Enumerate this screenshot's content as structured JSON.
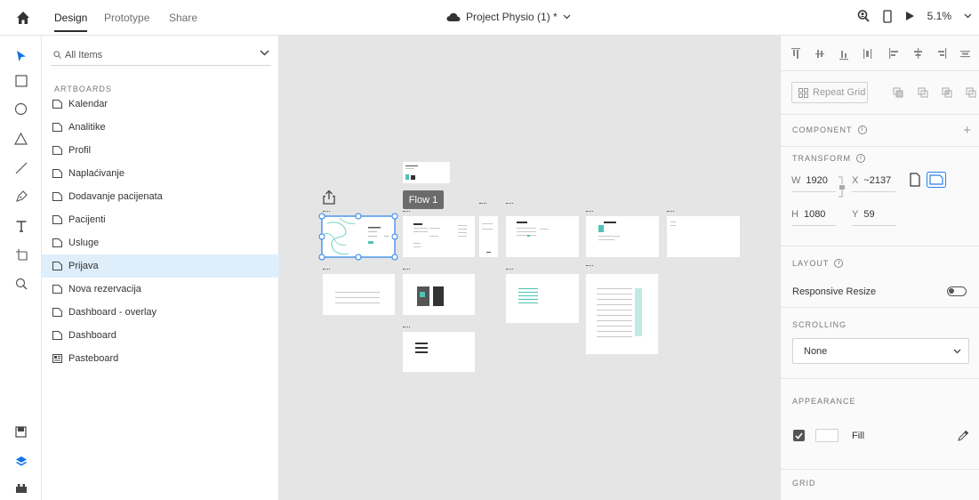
{
  "topbar": {
    "tabs": [
      {
        "label": "Design"
      },
      {
        "label": "Prototype"
      },
      {
        "label": "Share"
      }
    ],
    "document_title": "Project Physio (1) *",
    "zoom": "5.1%"
  },
  "layers": {
    "search_placeholder": "All Items",
    "section_label": "ARTBOARDS",
    "items": [
      {
        "label": "Kalendar"
      },
      {
        "label": "Analitike"
      },
      {
        "label": "Profil"
      },
      {
        "label": "Naplaćivanje"
      },
      {
        "label": "Dodavanje pacijenata"
      },
      {
        "label": "Pacijenti"
      },
      {
        "label": "Usluge"
      },
      {
        "label": "Prijava"
      },
      {
        "label": "Nova rezervacija"
      },
      {
        "label": "Dashboard - overlay"
      },
      {
        "label": "Dashboard"
      },
      {
        "label": "Pasteboard"
      }
    ],
    "selected_index": 7
  },
  "canvas": {
    "flow_label": "Flow 1"
  },
  "props": {
    "repeat_grid_label": "Repeat Grid",
    "component_title": "COMPONENT",
    "transform_title": "TRANSFORM",
    "w_label": "W",
    "w_value": "1920",
    "x_label": "X",
    "x_value": "~2137",
    "h_label": "H",
    "h_value": "1080",
    "y_label": "Y",
    "y_value": "59",
    "layout_title": "LAYOUT",
    "responsive_label": "Responsive Resize",
    "scrolling_title": "SCROLLING",
    "scrolling_value": "None",
    "appearance_title": "APPEARANCE",
    "fill_label": "Fill",
    "grid_title": "GRID",
    "info_glyph": "i",
    "plus_glyph": "+"
  }
}
